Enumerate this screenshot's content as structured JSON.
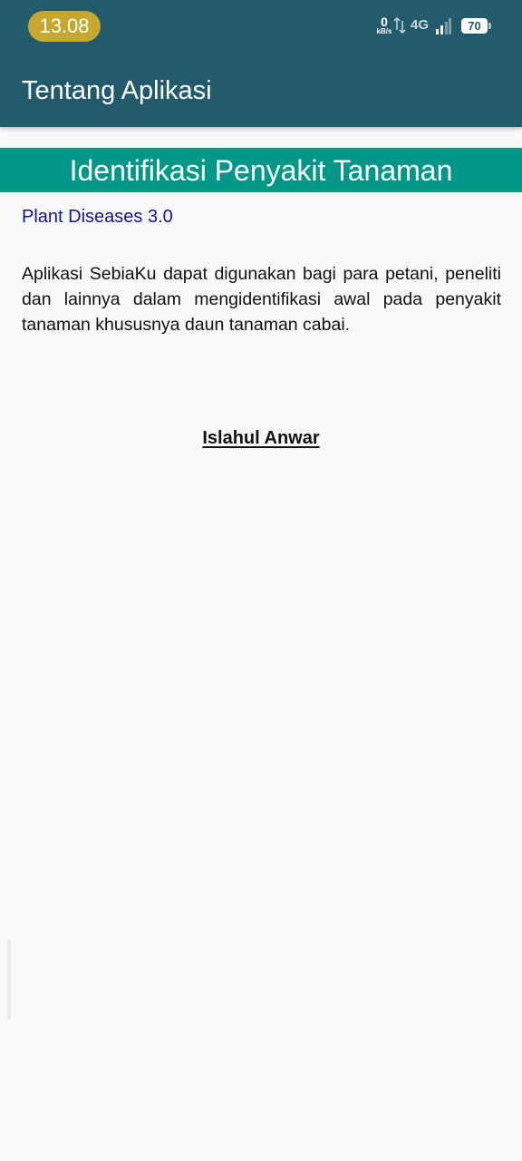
{
  "status_bar": {
    "time": "13.08",
    "net_speed_value": "0",
    "net_speed_unit": "kB/s",
    "network_type": "4G",
    "battery_level": "70",
    "signal_strength_bars": 2
  },
  "app_bar": {
    "title": "Tentang Aplikasi",
    "color": "#235b6d"
  },
  "content": {
    "banner_title": "Identifikasi Penyakit Tanaman",
    "banner_color": "#009688",
    "version": "Plant Diseases 3.0",
    "description": "Aplikasi SebiaKu dapat digunakan bagi para petani, peneliti dan lainnya dalam mengidentifikasi awal pada penyakit tanaman khususnya daun tanaman cabai.",
    "author": "Islahul Anwar"
  }
}
